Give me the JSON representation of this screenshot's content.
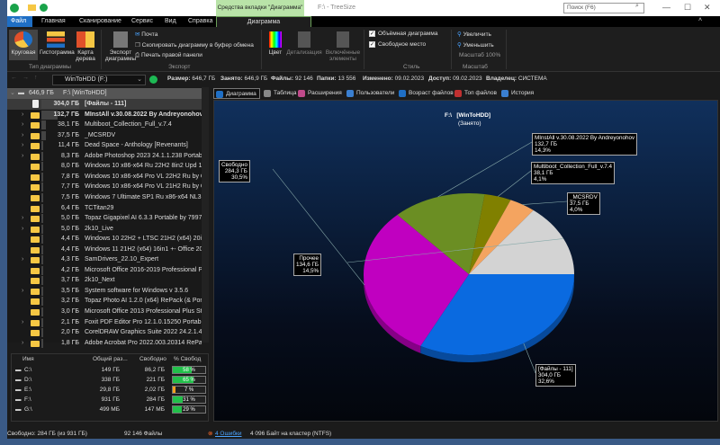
{
  "window": {
    "context_tab": "Средства вкладки \"Диаграмма\"",
    "title": "F:\\ - TreeSize",
    "search_placeholder": "Поиск (F6)"
  },
  "menu_tabs": [
    "Файл",
    "Главная",
    "Сканирование",
    "Сервис",
    "Вид",
    "Справка",
    "Диаграмма"
  ],
  "ribbon": {
    "chart_type": {
      "label": "Тип диаграммы",
      "buttons": [
        "Круговая",
        "Гистограмма",
        "Карта дерева"
      ]
    },
    "export": {
      "label": "Экспорт",
      "big": "Экспорт диаграммы",
      "items": [
        "Почта",
        "Скопировать диаграмму в буфер обмена",
        "Печать правой панели"
      ]
    },
    "style": {
      "label": "Стиль",
      "buttons": [
        "Цвет",
        "Детализация",
        "Включённые элементы"
      ],
      "checks": [
        {
          "label": "Объёмная диаграмма",
          "checked": true
        },
        {
          "label": "Свободное место",
          "checked": true
        }
      ]
    },
    "zoom": {
      "label": "Масштаб",
      "items": [
        "Увеличить",
        "Уменьшить"
      ],
      "value": "Масштаб 100%"
    }
  },
  "address": {
    "drive": "WinToHDD (F:)",
    "size_k": "Размер:",
    "size": "646,7 ГБ",
    "used_k": "Занято:",
    "used": "646,9 ГБ",
    "files_k": "Файлы:",
    "files": "92 146",
    "folders_k": "Папки:",
    "folders": "13 556",
    "modified_k": "Изменено:",
    "modified": "09.02.2023",
    "access_k": "Доступ:",
    "access": "09.02.2023",
    "owner_k": "Владелец:",
    "owner": "СИСТЕМА"
  },
  "tree": {
    "root": {
      "size": "646,9 ГБ",
      "name": "F:\\   [WinToHDD]"
    },
    "items": [
      {
        "size": "304,0 ГБ",
        "name": "[Файлы - 111]",
        "bold": true,
        "file": true,
        "pct": 100
      },
      {
        "size": "132,7 ГБ",
        "name": "MInstAll v.30.08.2022 By Andreyonohov",
        "bold": true,
        "exp": true,
        "pct": 44
      },
      {
        "size": "38,1 ГБ",
        "name": "Multiboot_Collection_Full_v.7.4",
        "exp": true,
        "pct": 13
      },
      {
        "size": "37,5 ГБ",
        "name": "_MCSRDV",
        "exp": true,
        "pct": 12
      },
      {
        "size": "11,4 ГБ",
        "name": "Dead Space - Anthology [Revenants]",
        "exp": true,
        "pct": 4
      },
      {
        "size": "8,3 ГБ",
        "name": "Adobe Photoshop 2023 24.1.1.238 Portable by",
        "exp": true,
        "pct": 3
      },
      {
        "size": "8,0 ГБ",
        "name": "Windows 10 x86-x64 Ru 22H2 8in2 Upd 10.20",
        "pct": 3
      },
      {
        "size": "7,8 ГБ",
        "name": "Windows 10 x86-x64 Pro VL 22H2 Ru by OVG",
        "pct": 3
      },
      {
        "size": "7,7 ГБ",
        "name": "Windows 10 x86-x64 Pro VL 21H2 Ru by OVG",
        "pct": 3
      },
      {
        "size": "7,5 ГБ",
        "name": "Windows 7 Ultimate SP1 Ru x86-x64 NL3 by C",
        "pct": 2
      },
      {
        "size": "6,4 ГБ",
        "name": "TCTitan29",
        "pct": 2
      },
      {
        "size": "5,0 ГБ",
        "name": "Topaz Gigapixel AI 6.3.3 Portable by 7997",
        "exp": true,
        "pct": 2
      },
      {
        "size": "5,0 ГБ",
        "name": "2k10_Live",
        "exp": true,
        "pct": 2
      },
      {
        "size": "4,4 ГБ",
        "name": "Windows 10 22H2 + LTSC 21H2 (x64) 20in1 +-",
        "pct": 1
      },
      {
        "size": "4,4 ГБ",
        "name": "Windows 11 21H2 (x64) 16in1 +- Office 2021",
        "pct": 1
      },
      {
        "size": "4,3 ГБ",
        "name": "SamDrivers_22.10_Expert",
        "exp": true,
        "pct": 1
      },
      {
        "size": "4,2 ГБ",
        "name": "Microsoft Office 2016-2019 Professional Plus",
        "pct": 1
      },
      {
        "size": "3,7 ГБ",
        "name": "2k10_Next",
        "pct": 1
      },
      {
        "size": "3,5 ГБ",
        "name": "System software for Windows v 3.5.6",
        "exp": true,
        "pct": 1
      },
      {
        "size": "3,2 ГБ",
        "name": "Topaz Photo AI 1.2.0 (x64) RePack (& Portable",
        "pct": 1
      },
      {
        "size": "3,0 ГБ",
        "name": "Microsoft Office 2013 Professional Plus  Stand",
        "pct": 1
      },
      {
        "size": "2,1 ГБ",
        "name": "Foxit PDF Editor Pro 12.1.0.15250 Portable by",
        "exp": true,
        "pct": 1
      },
      {
        "size": "2,0 ГБ",
        "name": "CorelDRAW Graphics Suite 2022 24.2.1.446 (x6",
        "pct": 1
      },
      {
        "size": "1,8 ГБ",
        "name": "Adobe Acrobat Pro 2022.003.20314 RePack by",
        "exp": true,
        "pct": 1
      }
    ]
  },
  "drives": {
    "headers": [
      "Имя",
      "Общий раз...",
      "Свободно",
      "% Свобод"
    ],
    "rows": [
      {
        "name": "C:\\",
        "total": "149 ГБ",
        "free": "86,2 ГБ",
        "pct_label": "58 %",
        "pct": 58
      },
      {
        "name": "D:\\",
        "total": "338 ГБ",
        "free": "221 ГБ",
        "pct_label": "65 %",
        "pct": 65
      },
      {
        "name": "E:\\",
        "total": "29,8 ГБ",
        "free": "2,02 ГБ",
        "pct_label": "7 %",
        "pct": 7,
        "warn": true
      },
      {
        "name": "F:\\",
        "total": "931 ГБ",
        "free": "284 ГБ",
        "pct_label": "31 %",
        "pct": 31
      },
      {
        "name": "G:\\",
        "total": "499 МБ",
        "free": "147 МБ",
        "pct_label": "29 %",
        "pct": 29
      }
    ]
  },
  "status": {
    "free": "Свободно: 284 ГБ  (из 931 ГБ)",
    "files": "92 146 Файлы",
    "errors": "4 Ошибки",
    "cluster": "4 096 Байт на кластер (NTFS)"
  },
  "view_tabs": [
    "Диаграмма",
    "Таблица",
    "Расширения",
    "Пользователи",
    "Возраст файлов",
    "Топ файлов",
    "История"
  ],
  "chart_data": {
    "type": "pie",
    "title": "F:\\   [WinToHDD]",
    "subtitle": "(Занято)",
    "slices": [
      {
        "name": "[Файлы - 111]",
        "size": "304,0 ГБ",
        "value": 32.6,
        "pct": "32,6%",
        "color": "#0a6ae0"
      },
      {
        "name": "Свободно",
        "size": "284,3 ГБ",
        "value": 30.5,
        "pct": "30,5%",
        "color": "#c000c0"
      },
      {
        "name": "MInstAll v.30.08.2022 By Andreyonohov",
        "size": "132,7 ГБ",
        "value": 14.3,
        "pct": "14,3%",
        "color": "#6b8e23"
      },
      {
        "name": "Multiboot_Collection_Full_v.7.4",
        "size": "38,1 ГБ",
        "value": 4.1,
        "pct": "4,1%",
        "color": "#808000"
      },
      {
        "name": "_MCSRDV",
        "size": "37,5 ГБ",
        "value": 4.0,
        "pct": "4,0%",
        "color": "#f4a460"
      },
      {
        "name": "Прочее",
        "size": "134,6 ГБ",
        "value": 14.5,
        "pct": "14,5%",
        "color": "#d3d3d3"
      }
    ]
  }
}
